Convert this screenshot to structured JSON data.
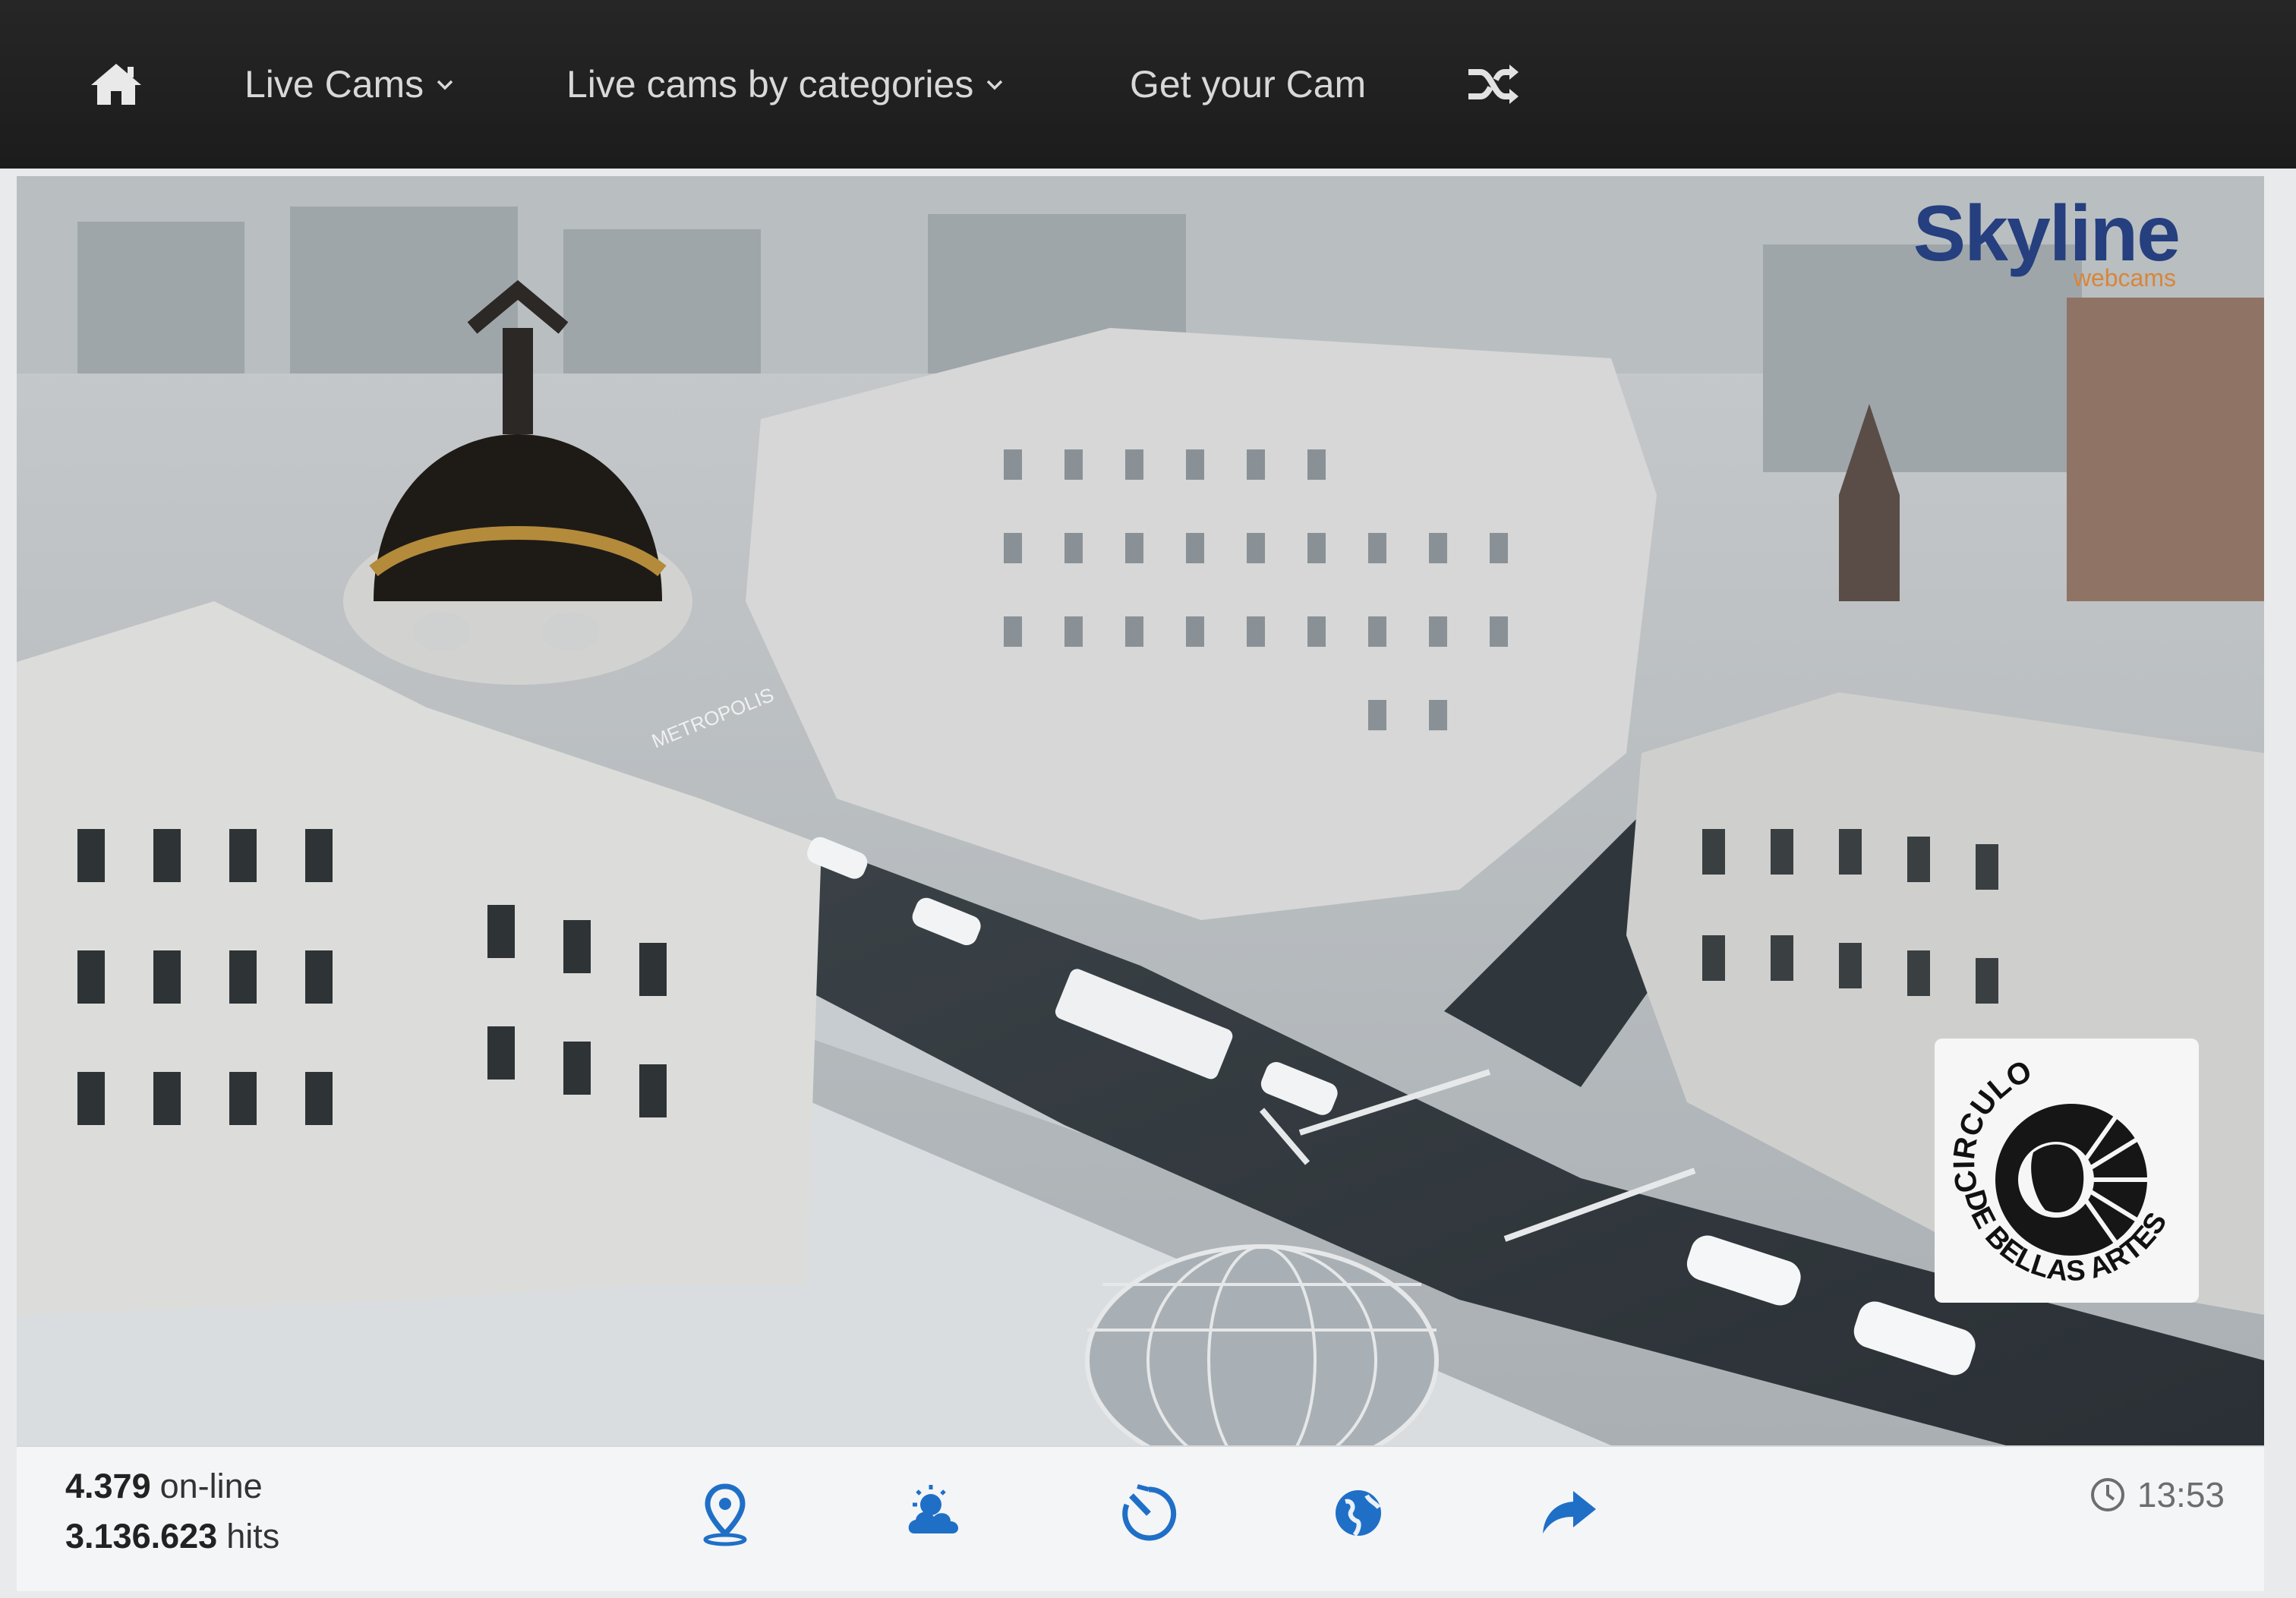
{
  "nav": {
    "home_icon": "home-icon",
    "items": [
      {
        "label": "Live Cams",
        "has_dropdown": true
      },
      {
        "label": "Live cams by categories",
        "has_dropdown": true
      },
      {
        "label": "Get your Cam",
        "has_dropdown": false
      }
    ],
    "shuffle_icon": "shuffle-icon"
  },
  "stream": {
    "brand": {
      "name": "Skyline",
      "subtitle": "webcams"
    },
    "sponsor": {
      "top_text": "CIRCULO",
      "bottom_text": "DE BELLAS ARTES"
    },
    "building_sign": "METROPOLIS"
  },
  "infobar": {
    "online_count": "4.379",
    "online_label": "on-line",
    "hits_count": "3.136.623",
    "hits_label": "hits",
    "icons": [
      "location-pin-icon",
      "weather-icon",
      "timelapse-icon",
      "globe-icon",
      "share-icon"
    ],
    "time": "13:53"
  },
  "colors": {
    "navbar": "#1f1f1f",
    "nav_text": "#d8d8d8",
    "accent_blue": "#1f6fc7",
    "brand_blue": "#253f7f",
    "brand_orange": "#d7863a"
  }
}
